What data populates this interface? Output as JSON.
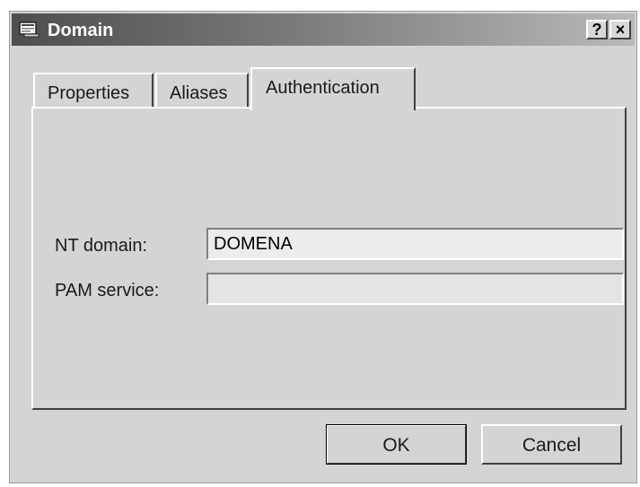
{
  "window": {
    "title": "Domain",
    "help_label": "?",
    "close_label": "×"
  },
  "tabs": [
    {
      "label": "Properties"
    },
    {
      "label": "Aliases"
    },
    {
      "label": "Authentication",
      "active": true
    }
  ],
  "form": {
    "nt_domain_label": "NT domain:",
    "nt_domain_value": "DOMENA",
    "pam_service_label": "PAM service:",
    "pam_service_value": ""
  },
  "buttons": {
    "ok_label": "OK",
    "cancel_label": "Cancel"
  },
  "icons": {
    "app": "domain-window-icon",
    "help": "help-icon",
    "close": "close-icon"
  }
}
